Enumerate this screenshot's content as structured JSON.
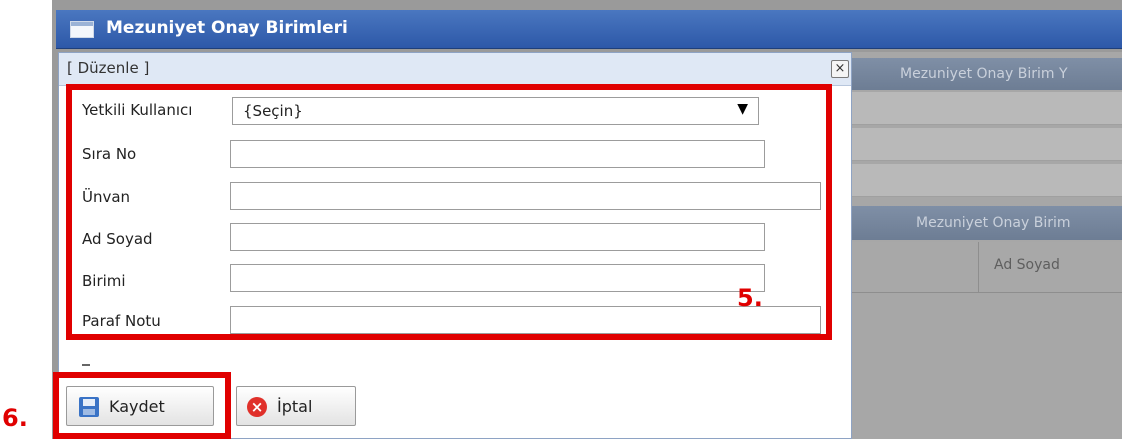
{
  "window": {
    "title": "Mezuniyet Onay Birimleri"
  },
  "background": {
    "header1": "Mezuniyet Onay Birim Y",
    "header2": "Mezuniyet Onay Birim",
    "column_ad_soyad": "Ad Soyad"
  },
  "dialog": {
    "title": "[ Düzenle ]",
    "close_label": "×",
    "fields": [
      {
        "label": "Yetkili Kullanıcı",
        "value": "{Seçin}"
      },
      {
        "label": "Sıra No",
        "value": ""
      },
      {
        "label": "Ünvan",
        "value": ""
      },
      {
        "label": "Ad Soyad",
        "value": ""
      },
      {
        "label": "Birimi",
        "value": ""
      },
      {
        "label": "Paraf Notu",
        "value": ""
      }
    ],
    "select_arrow": "▼",
    "buttons": {
      "save_label": "Kaydet",
      "cancel_label": "İptal"
    }
  },
  "annotations": {
    "box5": "5.",
    "box6": "6."
  },
  "colors": {
    "title_bar": "#2d58a8",
    "annotation": "#e00000"
  }
}
